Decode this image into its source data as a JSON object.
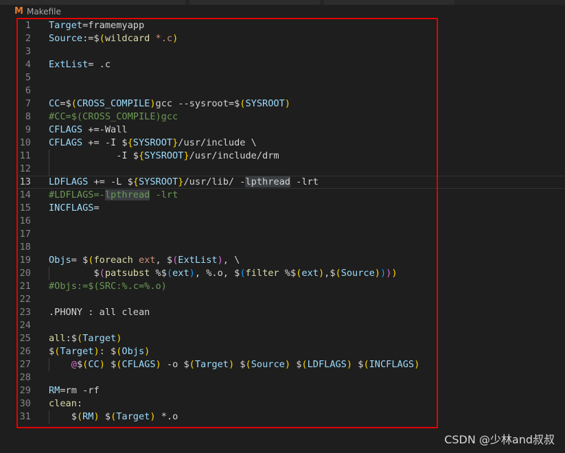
{
  "breadcrumb": {
    "icon_letter": "M",
    "file_name": "Makefile"
  },
  "watermark": "CSDN @少林and叔叔",
  "lines": [
    {
      "n": "1",
      "segs": [
        [
          "var",
          "Target"
        ],
        [
          "plain",
          "=framemyapp"
        ]
      ]
    },
    {
      "n": "2",
      "segs": [
        [
          "var",
          "Source"
        ],
        [
          "plain",
          ":="
        ],
        [
          "plain",
          "$"
        ],
        [
          "paren1",
          "("
        ],
        [
          "func",
          "wildcard"
        ],
        [
          "str",
          " *.c"
        ],
        [
          "paren1",
          ")"
        ]
      ]
    },
    {
      "n": "3",
      "segs": []
    },
    {
      "n": "4",
      "segs": [
        [
          "var",
          "ExtList"
        ],
        [
          "plain",
          "= .c"
        ]
      ]
    },
    {
      "n": "5",
      "segs": []
    },
    {
      "n": "6",
      "segs": []
    },
    {
      "n": "7",
      "segs": [
        [
          "var",
          "CC"
        ],
        [
          "plain",
          "="
        ],
        [
          "plain",
          "$"
        ],
        [
          "paren1",
          "("
        ],
        [
          "var",
          "CROSS_COMPILE"
        ],
        [
          "paren1",
          ")"
        ],
        [
          "plain",
          "gcc --sysroot="
        ],
        [
          "plain",
          "$"
        ],
        [
          "paren1",
          "("
        ],
        [
          "var",
          "SYSROOT"
        ],
        [
          "paren1",
          ")"
        ]
      ]
    },
    {
      "n": "8",
      "segs": [
        [
          "comment",
          "#CC=$(CROSS_COMPILE)gcc"
        ]
      ]
    },
    {
      "n": "9",
      "segs": [
        [
          "var",
          "CFLAGS"
        ],
        [
          "plain",
          " +=-Wall"
        ]
      ]
    },
    {
      "n": "10",
      "segs": [
        [
          "var",
          "CFLAGS"
        ],
        [
          "plain",
          " += -I "
        ],
        [
          "plain",
          "$"
        ],
        [
          "brace",
          "{"
        ],
        [
          "var",
          "SYSROOT"
        ],
        [
          "brace",
          "}"
        ],
        [
          "plain",
          "/usr/include \\"
        ]
      ]
    },
    {
      "n": "11",
      "segs": [
        [
          "plain",
          "            -I "
        ],
        [
          "plain",
          "$"
        ],
        [
          "brace",
          "{"
        ],
        [
          "var",
          "SYSROOT"
        ],
        [
          "brace",
          "}"
        ],
        [
          "plain",
          "/usr/include/drm"
        ]
      ]
    },
    {
      "n": "12",
      "segs": []
    },
    {
      "n": "13",
      "current": true,
      "segs": [
        [
          "var",
          "LDFLAGS"
        ],
        [
          "plain",
          " += -L "
        ],
        [
          "plain",
          "$"
        ],
        [
          "brace",
          "{"
        ],
        [
          "var",
          "SYSROOT"
        ],
        [
          "brace",
          "}"
        ],
        [
          "plain",
          "/usr/lib/ -"
        ],
        [
          "hl",
          "lpthread"
        ],
        [
          "plain",
          " -lrt"
        ]
      ]
    },
    {
      "n": "14",
      "segs": [
        [
          "comment",
          "#LDFLAGS=-"
        ],
        [
          "hlc",
          "lpthread"
        ],
        [
          "comment",
          " -lrt"
        ]
      ]
    },
    {
      "n": "15",
      "segs": [
        [
          "var",
          "INCFLAGS"
        ],
        [
          "plain",
          "="
        ]
      ]
    },
    {
      "n": "16",
      "segs": []
    },
    {
      "n": "17",
      "segs": []
    },
    {
      "n": "18",
      "segs": []
    },
    {
      "n": "19",
      "segs": [
        [
          "var",
          "Objs"
        ],
        [
          "plain",
          "= "
        ],
        [
          "plain",
          "$"
        ],
        [
          "paren1",
          "("
        ],
        [
          "func",
          "foreach"
        ],
        [
          "str",
          " ext"
        ],
        [
          "plain",
          ", "
        ],
        [
          "plain",
          "$"
        ],
        [
          "paren2",
          "("
        ],
        [
          "var",
          "ExtList"
        ],
        [
          "paren2",
          ")"
        ],
        [
          "plain",
          ", \\"
        ]
      ]
    },
    {
      "n": "20",
      "segs": [
        [
          "plain",
          "        "
        ],
        [
          "plain",
          "$"
        ],
        [
          "paren2",
          "("
        ],
        [
          "func",
          "patsubst"
        ],
        [
          "plain",
          " %"
        ],
        [
          "plain",
          "$"
        ],
        [
          "paren3",
          "("
        ],
        [
          "var",
          "ext"
        ],
        [
          "paren3",
          ")"
        ],
        [
          "plain",
          ", %.o, "
        ],
        [
          "plain",
          "$"
        ],
        [
          "paren3",
          "("
        ],
        [
          "func",
          "filter"
        ],
        [
          "plain",
          " %"
        ],
        [
          "plain",
          "$"
        ],
        [
          "paren1",
          "("
        ],
        [
          "var",
          "ext"
        ],
        [
          "paren1",
          ")"
        ],
        [
          "plain",
          ","
        ],
        [
          "plain",
          "$"
        ],
        [
          "paren1",
          "("
        ],
        [
          "var",
          "Source"
        ],
        [
          "paren1",
          ")"
        ],
        [
          "paren3",
          ")"
        ],
        [
          "paren2",
          ")"
        ],
        [
          "paren1",
          ")"
        ]
      ]
    },
    {
      "n": "21",
      "segs": [
        [
          "comment",
          "#Objs:=$(SRC:%.c=%.o)"
        ]
      ]
    },
    {
      "n": "22",
      "segs": []
    },
    {
      "n": "23",
      "segs": [
        [
          "plain",
          ".PHONY : all clean"
        ]
      ]
    },
    {
      "n": "24",
      "segs": []
    },
    {
      "n": "25",
      "segs": [
        [
          "func",
          "all"
        ],
        [
          "plain",
          ":"
        ],
        [
          "plain",
          "$"
        ],
        [
          "paren1",
          "("
        ],
        [
          "var",
          "Target"
        ],
        [
          "paren1",
          ")"
        ]
      ]
    },
    {
      "n": "26",
      "segs": [
        [
          "plain",
          "$"
        ],
        [
          "paren1",
          "("
        ],
        [
          "var",
          "Target"
        ],
        [
          "paren1",
          ")"
        ],
        [
          "plain",
          ": "
        ],
        [
          "plain",
          "$"
        ],
        [
          "paren1",
          "("
        ],
        [
          "var",
          "Objs"
        ],
        [
          "paren1",
          ")"
        ]
      ]
    },
    {
      "n": "27",
      "segs": [
        [
          "plain",
          "    "
        ],
        [
          "paren2",
          "@"
        ],
        [
          "plain",
          "$"
        ],
        [
          "paren1",
          "("
        ],
        [
          "var",
          "CC"
        ],
        [
          "paren1",
          ")"
        ],
        [
          "plain",
          " "
        ],
        [
          "plain",
          "$"
        ],
        [
          "paren1",
          "("
        ],
        [
          "var",
          "CFLAGS"
        ],
        [
          "paren1",
          ")"
        ],
        [
          "plain",
          " -o "
        ],
        [
          "plain",
          "$"
        ],
        [
          "paren1",
          "("
        ],
        [
          "var",
          "Target"
        ],
        [
          "paren1",
          ")"
        ],
        [
          "plain",
          " "
        ],
        [
          "plain",
          "$"
        ],
        [
          "paren1",
          "("
        ],
        [
          "var",
          "Source"
        ],
        [
          "paren1",
          ")"
        ],
        [
          "plain",
          " "
        ],
        [
          "plain",
          "$"
        ],
        [
          "paren1",
          "("
        ],
        [
          "var",
          "LDFLAGS"
        ],
        [
          "paren1",
          ")"
        ],
        [
          "plain",
          " "
        ],
        [
          "plain",
          "$"
        ],
        [
          "paren1",
          "("
        ],
        [
          "var",
          "INCFLAGS"
        ],
        [
          "paren1",
          ")"
        ]
      ]
    },
    {
      "n": "28",
      "segs": []
    },
    {
      "n": "29",
      "segs": [
        [
          "var",
          "RM"
        ],
        [
          "plain",
          "=rm -rf"
        ]
      ]
    },
    {
      "n": "30",
      "segs": [
        [
          "func",
          "clean"
        ],
        [
          "plain",
          ":"
        ]
      ]
    },
    {
      "n": "31",
      "segs": [
        [
          "plain",
          "    "
        ],
        [
          "plain",
          "$"
        ],
        [
          "paren1",
          "("
        ],
        [
          "var",
          "RM"
        ],
        [
          "paren1",
          ")"
        ],
        [
          "plain",
          " "
        ],
        [
          "plain",
          "$"
        ],
        [
          "paren1",
          "("
        ],
        [
          "var",
          "Target"
        ],
        [
          "paren1",
          ")"
        ],
        [
          "plain",
          " *.o"
        ]
      ]
    }
  ]
}
